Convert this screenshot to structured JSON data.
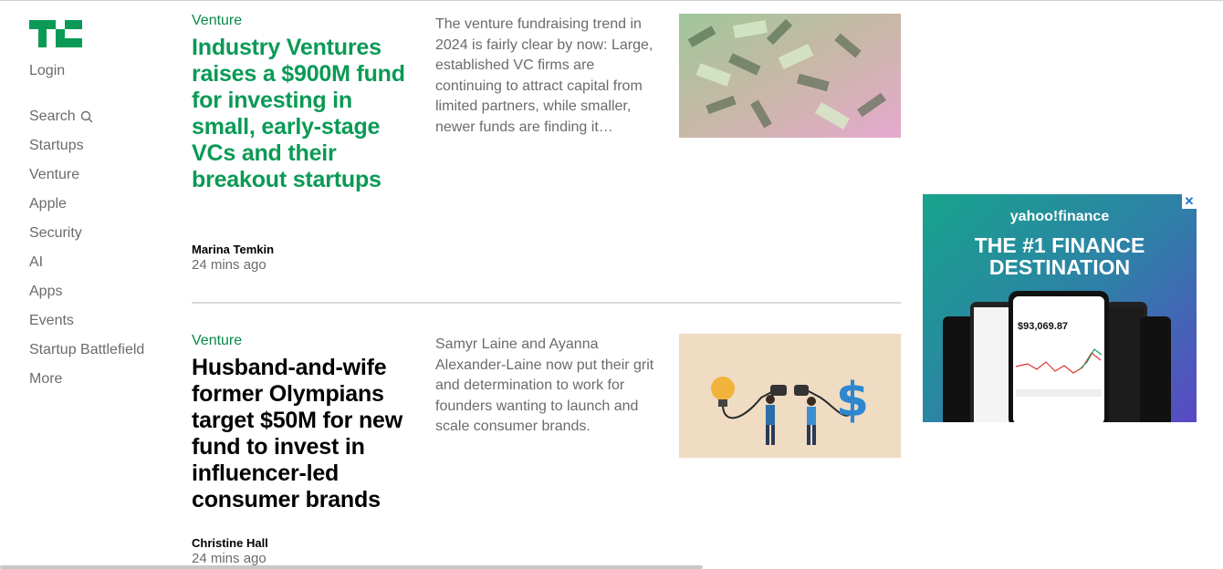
{
  "sidebar": {
    "login": "Login",
    "items": [
      {
        "label": "Search"
      },
      {
        "label": "Startups"
      },
      {
        "label": "Venture"
      },
      {
        "label": "Apple"
      },
      {
        "label": "Security"
      },
      {
        "label": "AI"
      },
      {
        "label": "Apps"
      },
      {
        "label": "Events"
      },
      {
        "label": "Startup Battlefield"
      },
      {
        "label": "More"
      }
    ]
  },
  "articles": [
    {
      "category": "Venture",
      "headline": "Industry Ventures raises a $900M fund for investing in small, early-stage VCs and their breakout startups",
      "summary": "The venture fundraising trend in 2024 is fairly clear by now: Large, established VC firms are continuing to attract capital from limited partners, while smaller, newer funds are finding it…",
      "author": "Marina Temkin",
      "time": "24 mins ago"
    },
    {
      "category": "Venture",
      "headline": "Husband-and-wife former Olympians target $50M for new fund to invest in influencer-led consumer brands",
      "summary": "Samyr Laine and Ayanna Alexander-Laine now put their grit and determination to work for founders wanting to launch and scale consumer brands.",
      "author": "Christine Hall",
      "time": "24 mins ago"
    }
  ],
  "ad": {
    "brand": "yahoo!finance",
    "headline_line1": "THE #1 FINANCE",
    "headline_line2": "DESTINATION",
    "close": "✕",
    "phone_value": "$93,069.87"
  },
  "colors": {
    "brand_green": "#0a9a55",
    "category_green": "#0a8a4b",
    "nav_gray": "#6b6b6b"
  }
}
